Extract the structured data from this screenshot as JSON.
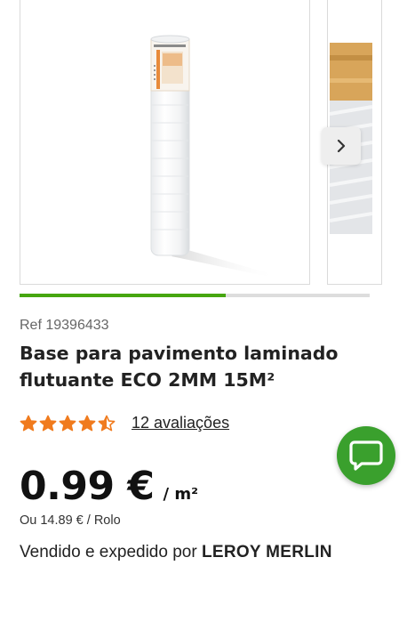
{
  "carousel": {
    "main_image_alt": "Rolo de base para pavimento laminado",
    "progress": 0.59
  },
  "product": {
    "ref": "Ref 19396433",
    "title_line1": "Base para pavimento laminado",
    "title_line2": "flutuante ECO 2MM 15M²",
    "rating": 4.5,
    "rating_max": 5,
    "reviews_label": "12 avaliações"
  },
  "price": {
    "value": "0.99 €",
    "unit": "/ m²",
    "alt": "Ou 14.89 € / Rolo"
  },
  "seller": {
    "prefix": "Vendido e expedido por",
    "name": "LEROY MERLIN"
  },
  "colors": {
    "accent_green": "#46a610",
    "star_orange": "#f07b1e",
    "chat_green": "#3aa02d"
  },
  "icons": {
    "next": "chevron-right-icon",
    "chat": "chat-bubble-icon",
    "star": "star-icon"
  }
}
